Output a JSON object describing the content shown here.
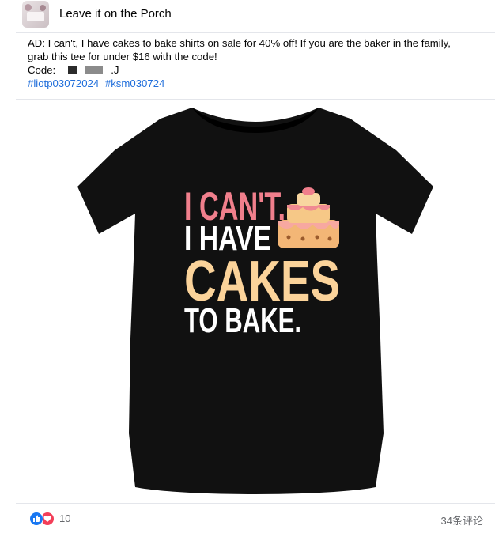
{
  "post": {
    "page_name": "Leave it on the Porch",
    "text_line1": "AD: I can't, I have cakes to bake shirts on sale for 40% off! If you are the baker in the family,",
    "text_line2": "grab this tee for under $16 with the code!",
    "code_label": "Code:",
    "code_suffix": ".J",
    "hashtags": [
      "#liotp03072024",
      "#ksm030724"
    ]
  },
  "image": {
    "tee_line1": "I CAN'T.",
    "tee_line2": "I HAVE",
    "tee_line3": "CAKES",
    "tee_line4": "TO BAKE.",
    "colors": {
      "shirt": "#111111",
      "pink": "#f07f8c",
      "cream": "#fbd39a",
      "white": "#ffffff",
      "cake": "#f3b676"
    }
  },
  "footer": {
    "reactions": [
      "like-icon",
      "love-icon"
    ],
    "reaction_count": "10",
    "comment_count": "34条评论"
  }
}
